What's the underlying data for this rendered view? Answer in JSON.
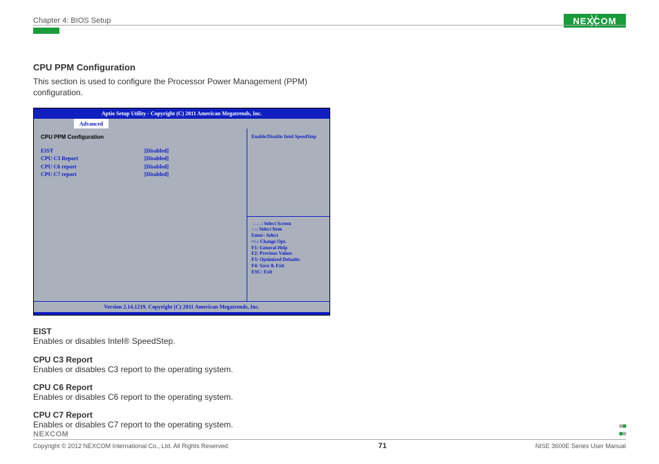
{
  "header": {
    "chapter": "Chapter 4: BIOS Setup",
    "logo_text": "NEXCOM"
  },
  "section": {
    "title": "CPU PPM Configuration",
    "desc": "This section is used to configure the Processor Power Management (PPM) configuration."
  },
  "bios": {
    "titlebar": "Aptio Setup Utility - Copyright (C) 2011 American Megatrends, Inc.",
    "tab": "Advanced",
    "left_title": "CPU PPM Configuration",
    "options": [
      {
        "label": "EIST",
        "value": "[Disabled]"
      },
      {
        "label": "CPU C3 Report",
        "value": "[Disabled]"
      },
      {
        "label": "CPU C6 report",
        "value": "[Disabled]"
      },
      {
        "label": "CPU C7 report",
        "value": "[Disabled]"
      }
    ],
    "help_top": "Enable/Disable Intel SpeedStep",
    "help_keys": [
      "→←: Select Screen",
      "↑↓: Select Item",
      "Enter: Select",
      "+/-: Change Opt.",
      "F1: General Help",
      "F2: Previous Values",
      "F3: Optimized Defaults",
      "F4: Save & Exit",
      "ESC: Exit"
    ],
    "version": "Version 2.14.1219. Copyright (C) 2011 American Megatrends, Inc."
  },
  "definitions": [
    {
      "title": "EIST",
      "text": "Enables or disables Intel® SpeedStep."
    },
    {
      "title": "CPU C3 Report",
      "text": "Enables or disables C3 report to the operating system."
    },
    {
      "title": "CPU C6 Report",
      "text": "Enables or disables C6 report to the operating system."
    },
    {
      "title": "CPU C7 Report",
      "text": "Enables or disables C7 report to the operating system."
    }
  ],
  "footer": {
    "copyright": "Copyright © 2012 NEXCOM International Co., Ltd. All Rights Reserved.",
    "page": "71",
    "doc": "NISE 3600E Series User Manual",
    "logo_text": "NEXCOM"
  }
}
